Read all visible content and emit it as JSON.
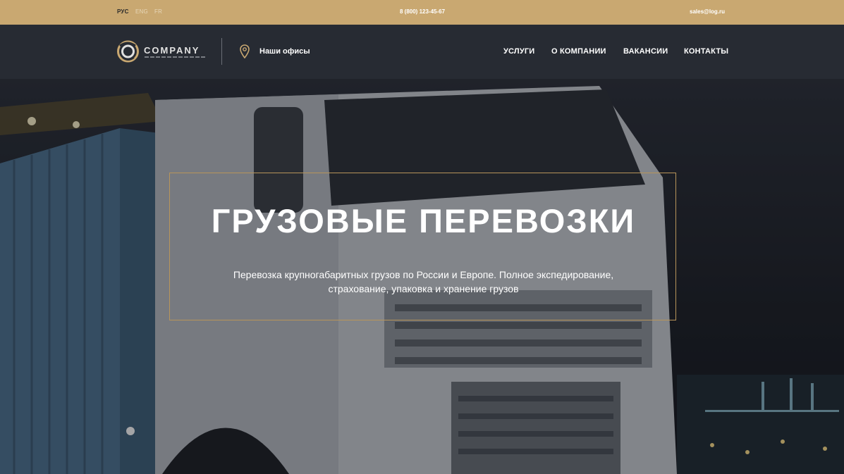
{
  "topbar": {
    "languages": [
      {
        "label": "РУС",
        "active": true
      },
      {
        "label": "ENG",
        "active": false
      },
      {
        "label": "FR",
        "active": false
      }
    ],
    "phone": "8 (800) 123-45-67",
    "email": "sales@log.ru"
  },
  "header": {
    "logo": {
      "name": "COMPANY",
      "icon": "logo-swirl-icon"
    },
    "offices": {
      "label": "Наши офисы",
      "icon": "map-pin-icon"
    },
    "nav": [
      {
        "label": "УСЛУГИ"
      },
      {
        "label": "О КОМПАНИИ"
      },
      {
        "label": "ВАКАНСИИ"
      },
      {
        "label": "КОНТАКТЫ"
      }
    ]
  },
  "hero": {
    "title": "ГРУЗОВЫЕ ПЕРЕВОЗКИ",
    "subtitle_line1": "Перевозка крупногабаритных грузов по России и Европе. Полное экспедирование,",
    "subtitle_line2": "страхование, упаковка и хранение грузов"
  },
  "colors": {
    "accent_gold": "#c9a871",
    "header_bg": "#272b33",
    "frame_border": "#b8955a"
  }
}
